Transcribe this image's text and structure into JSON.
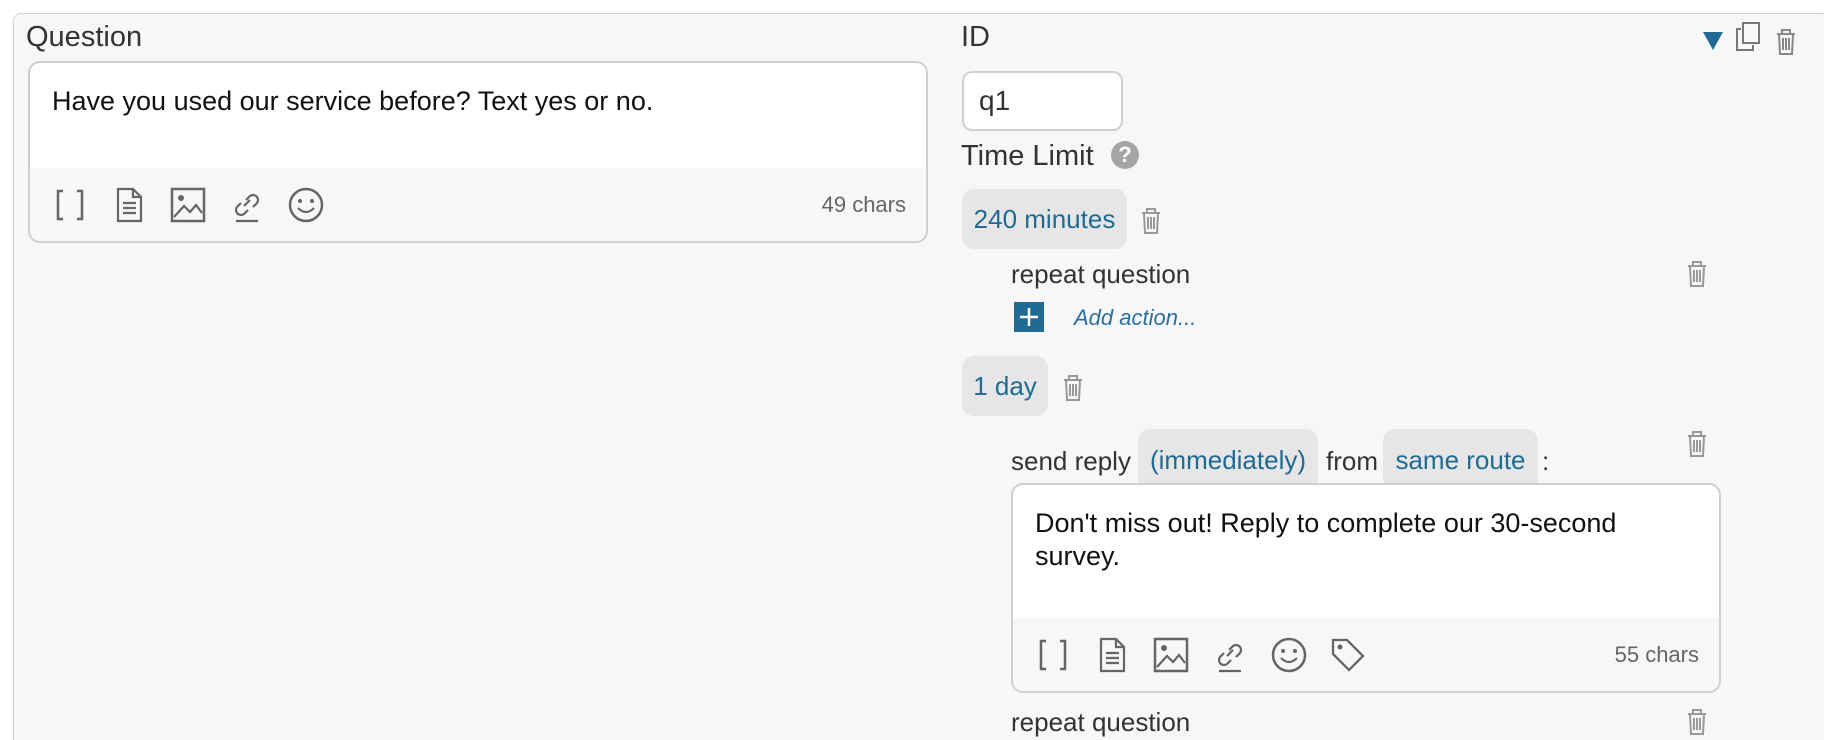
{
  "question": {
    "label": "Question",
    "text": "Have you used our service before? Text yes or no.",
    "chars": "49 chars"
  },
  "id_field": {
    "label": "ID",
    "value": "q1"
  },
  "time_limit": {
    "label": "Time Limit",
    "help": "?"
  },
  "rules": [
    {
      "duration": "240 minutes",
      "action": "repeat question",
      "add_action": "Add action..."
    },
    {
      "duration": "1 day",
      "send_prefix": "send reply",
      "timing": "(immediately)",
      "from_word": "from",
      "route": "same route",
      "colon": ":",
      "reply_text": "Don't miss out! Reply to complete our 30-second survey.",
      "reply_chars": "55 chars",
      "next_action": "repeat question"
    }
  ],
  "colors": {
    "accent": "#1f6b94",
    "panel_bg": "#f7f7f7",
    "pill_bg": "#e6e6e6"
  },
  "icons": {
    "toolbar": [
      "brackets-icon",
      "document-icon",
      "image-icon",
      "link-icon",
      "emoji-icon",
      "tag-icon"
    ],
    "header": [
      "caret-down-icon",
      "copy-icon",
      "trash-icon"
    ]
  }
}
